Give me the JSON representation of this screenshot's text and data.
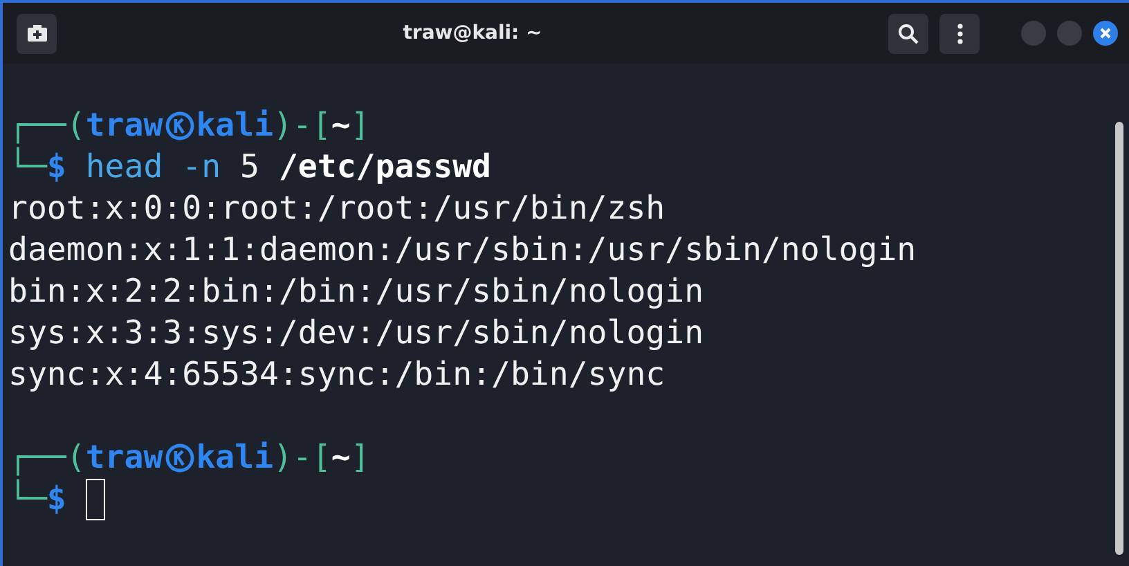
{
  "window": {
    "title": "traw@kali: ~"
  },
  "terminal": {
    "lines": [
      {
        "kind": "text",
        "segments": [
          {
            "text": "┌──(",
            "kind": "frame"
          },
          {
            "text": "traw",
            "kind": "user"
          },
          {
            "kind": "symbol"
          },
          {
            "text": "kali",
            "kind": "user"
          },
          {
            "text": ")-[",
            "kind": "frame"
          },
          {
            "text": "~",
            "kind": "path"
          },
          {
            "text": "]",
            "kind": "frame"
          }
        ]
      },
      {
        "kind": "text",
        "segments": [
          {
            "text": "└─",
            "kind": "frame"
          },
          {
            "text": "$",
            "kind": "user"
          },
          {
            "text": "head -n",
            "kind": "command",
            "gap": true
          },
          {
            "text": "5",
            "kind": "plain",
            "gap": true
          },
          {
            "text": "/etc/passwd",
            "kind": "path",
            "gap": true
          }
        ]
      },
      {
        "kind": "text",
        "segments": [
          {
            "text": "root:x:0:0:root:/root:/usr/bin/zsh",
            "kind": "plain"
          }
        ]
      },
      {
        "kind": "text",
        "segments": [
          {
            "text": "daemon:x:1:1:daemon:/usr/sbin:/usr/sbin/nologin",
            "kind": "plain"
          }
        ]
      },
      {
        "kind": "text",
        "segments": [
          {
            "text": "bin:x:2:2:bin:/bin:/usr/sbin/nologin",
            "kind": "plain"
          }
        ]
      },
      {
        "kind": "text",
        "segments": [
          {
            "text": "sys:x:3:3:sys:/dev:/usr/sbin/nologin",
            "kind": "plain"
          }
        ]
      },
      {
        "kind": "text",
        "segments": [
          {
            "text": "sync:x:4:65534:sync:/bin:/bin/sync",
            "kind": "plain"
          }
        ]
      },
      {
        "kind": "blank"
      },
      {
        "kind": "text",
        "segments": [
          {
            "text": "┌──(",
            "kind": "frame"
          },
          {
            "text": "traw",
            "kind": "user"
          },
          {
            "kind": "symbol"
          },
          {
            "text": "kali",
            "kind": "user"
          },
          {
            "text": ")-[",
            "kind": "frame"
          },
          {
            "text": "~",
            "kind": "path"
          },
          {
            "text": "]",
            "kind": "frame"
          }
        ]
      },
      {
        "kind": "text",
        "segments": [
          {
            "text": "└─",
            "kind": "frame"
          },
          {
            "text": "$",
            "kind": "user"
          },
          {
            "kind": "cursor",
            "gap": true
          }
        ]
      }
    ]
  }
}
